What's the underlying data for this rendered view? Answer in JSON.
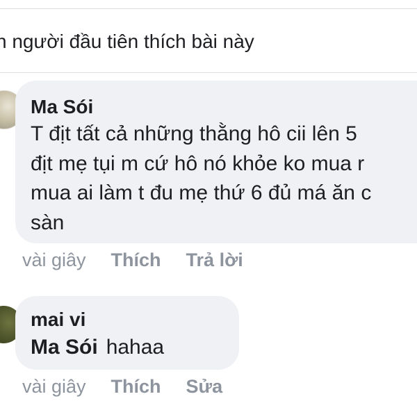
{
  "likes_banner": {
    "text": "n người đầu tiên thích bài này"
  },
  "comments": [
    {
      "author": "Ma Sói",
      "lines": [
        "T địt tất cả những thằng hô cii lên 5",
        "địt mẹ tụi m cứ hô nó khỏe ko mua r",
        "mua ai làm t đu mẹ thứ 6 đủ má ăn c",
        "sàn"
      ],
      "time": "vài giây",
      "like_label": "Thích",
      "reply_label": "Trả lời"
    },
    {
      "author": "mai vi",
      "mention": "Ma Sói",
      "text": "hahaa",
      "time": "vài giây",
      "like_label": "Thích",
      "edit_label": "Sửa"
    }
  ],
  "colors": {
    "bubble_bg": "#f0f1f4",
    "text": "#1c1e21",
    "meta_text": "#8d949e",
    "divider": "#dcdde0"
  }
}
